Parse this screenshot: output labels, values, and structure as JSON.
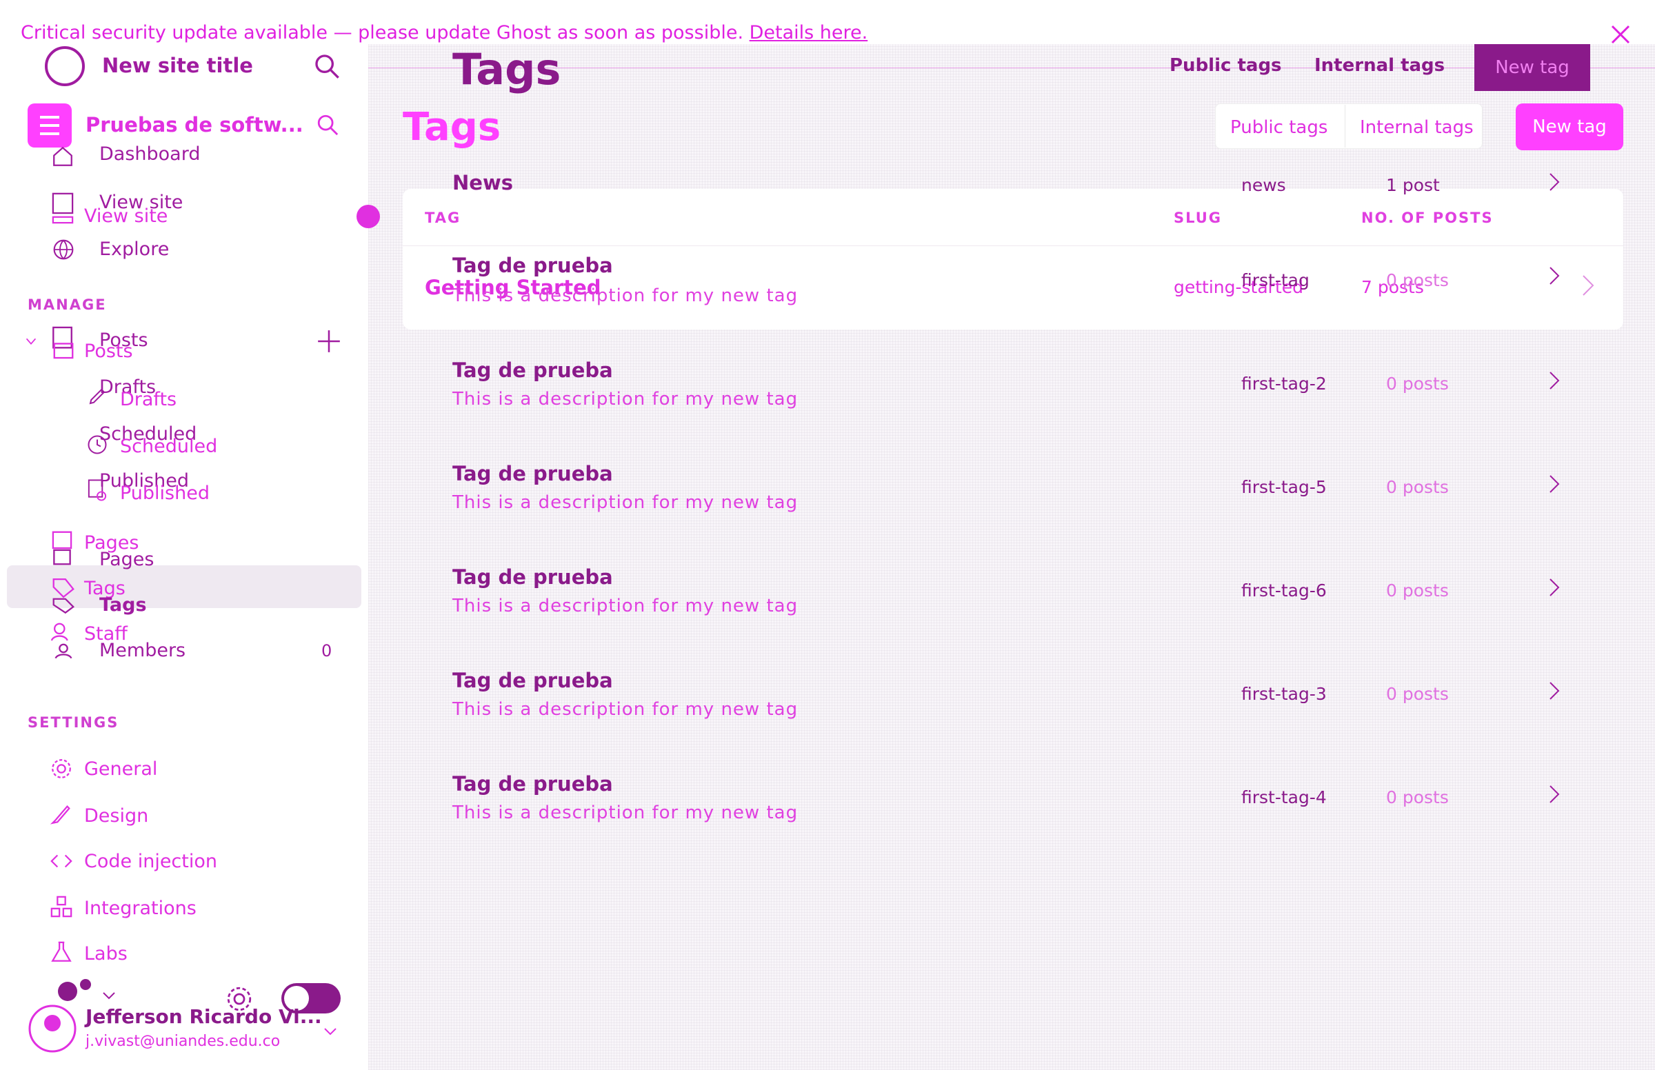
{
  "banner": {
    "text": "Critical security update available — please update Ghost as soon as possible.",
    "link": "Details here."
  },
  "sidebar": {
    "site_title": "New site title",
    "site_name": "Pruebas de softw...",
    "nav": {
      "dashboard": "Dashboard",
      "view_site": "View site",
      "explore": "Explore"
    },
    "manage_heading": "MANAGE",
    "posts": "Posts",
    "drafts": "Drafts",
    "scheduled": "Scheduled",
    "published": "Published",
    "pages": "Pages",
    "tags": "Tags",
    "staff": "Staff",
    "members": "Members",
    "members_count": "0",
    "settings_heading": "SETTINGS",
    "settings_items": {
      "general": "General",
      "design": "Design",
      "code_injection": "Code injection",
      "integrations": "Integrations",
      "labs": "Labs"
    },
    "user": {
      "name": "Jefferson Ricardo Vi...",
      "email": "j.vivast@uniandes.edu.co"
    }
  },
  "header": {
    "title": "Tags",
    "public_tags": "Public tags",
    "internal_tags": "Internal tags",
    "new_tag": "New tag"
  },
  "table": {
    "col_tag": "TAG",
    "col_slug": "SLUG",
    "col_posts": "NO. OF POSTS",
    "featured": {
      "name": "Getting Started",
      "slug": "getting-started",
      "posts": "7 posts"
    }
  },
  "rows": [
    {
      "name": "News",
      "desc": "",
      "slug": "news",
      "posts": "1 post"
    },
    {
      "name": "Tag de prueba",
      "desc": "This is a description for my new tag",
      "slug": "first-tag",
      "posts": "0 posts"
    },
    {
      "name": "Tag de prueba",
      "desc": "This is a description for my new tag",
      "slug": "first-tag-2",
      "posts": "0 posts"
    },
    {
      "name": "Tag de prueba",
      "desc": "This is a description for my new tag",
      "slug": "first-tag-5",
      "posts": "0 posts"
    },
    {
      "name": "Tag de prueba",
      "desc": "This is a description for my new tag",
      "slug": "first-tag-6",
      "posts": "0 posts"
    },
    {
      "name": "Tag de prueba",
      "desc": "This is a description for my new tag",
      "slug": "first-tag-3",
      "posts": "0 posts"
    },
    {
      "name": "Tag de prueba",
      "desc": "This is a description for my new tag",
      "slug": "first-tag-4",
      "posts": "0 posts"
    }
  ],
  "colors": {
    "accent": "#ff40ff",
    "dark_accent": "#8a1a8a",
    "highlight": "#efe9f1"
  }
}
